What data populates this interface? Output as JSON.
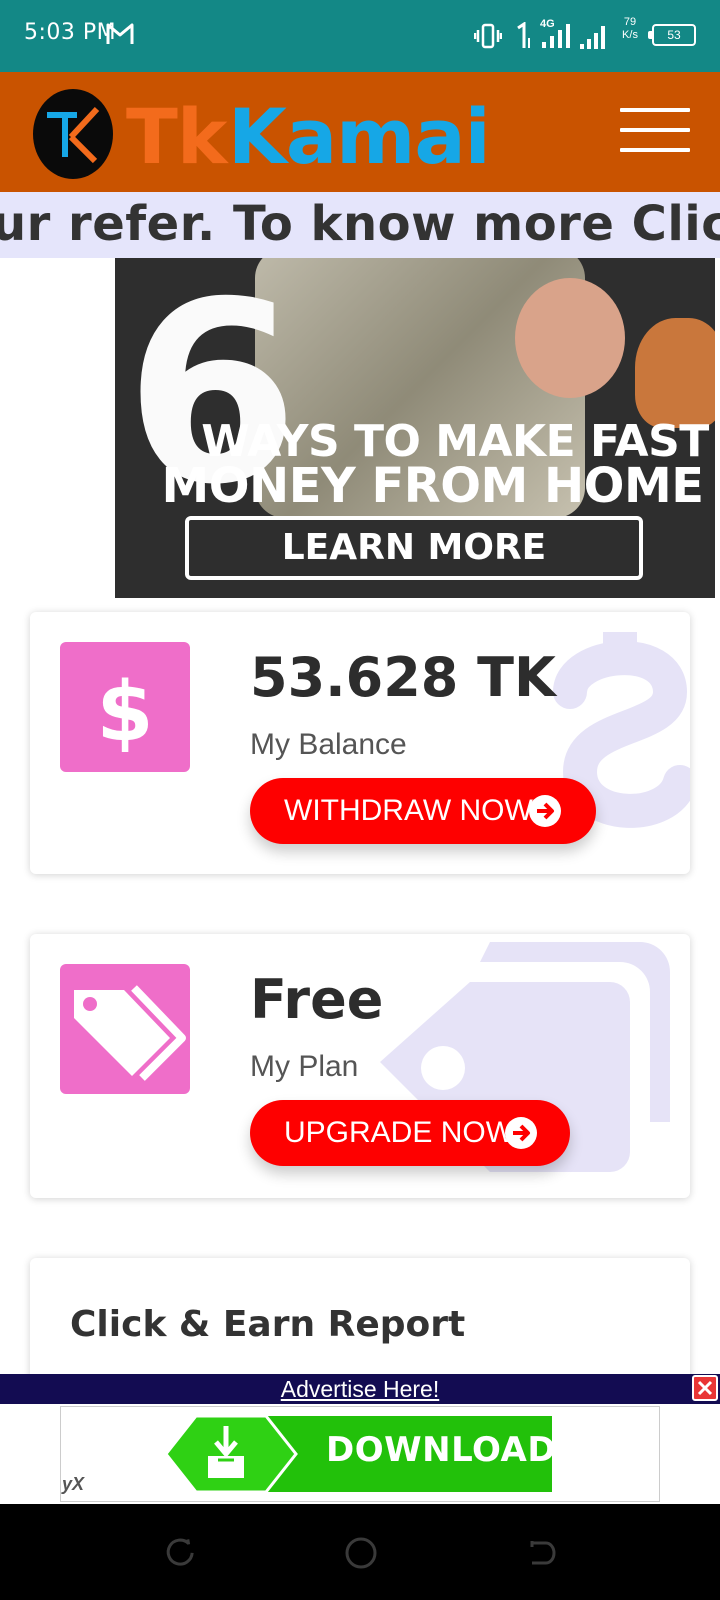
{
  "status_bar": {
    "time": "5:03 PM",
    "network_type": "4G",
    "net_speed_value": "79",
    "net_speed_unit": "K/s",
    "battery": "53"
  },
  "header": {
    "logo_tk": "Tk",
    "logo_kamai": "Kamai",
    "colors": {
      "header_bg": "#c95300",
      "logo_orange": "#f36b1c",
      "logo_blue": "#16a7e6"
    }
  },
  "marquee": {
    "text": "ur refer. To know more Click he"
  },
  "ad_banner": {
    "number": "6",
    "line1": "WAYS TO MAKE FAST",
    "line2": "MONEY FROM HOME",
    "cta": "LEARN MORE"
  },
  "balance_card": {
    "value": "53.628 TK",
    "label": "My Balance",
    "button": "WITHDRAW NOW",
    "icon": "dollar-icon"
  },
  "plan_card": {
    "value": "Free",
    "label": "My Plan",
    "button": "UPGRADE NOW",
    "icon": "tags-icon"
  },
  "report_card": {
    "title": "Click & Earn Report"
  },
  "bottom_ad": {
    "advertise_link": "Advertise Here!",
    "download_label": "DOWNLOAD",
    "badge": "yX"
  },
  "colors": {
    "accent_pink": "#ef6ec9",
    "button_red": "#fe0000",
    "status_teal": "#138886"
  }
}
